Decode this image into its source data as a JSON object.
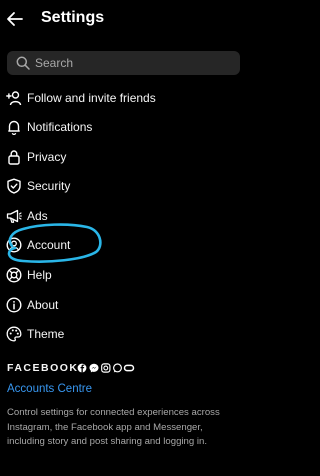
{
  "header": {
    "title": "Settings"
  },
  "search": {
    "placeholder": "Search"
  },
  "menu": {
    "items": [
      {
        "label": "Follow and invite friends"
      },
      {
        "label": "Notifications"
      },
      {
        "label": "Privacy"
      },
      {
        "label": "Security"
      },
      {
        "label": "Ads"
      },
      {
        "label": "Account"
      },
      {
        "label": "Help"
      },
      {
        "label": "About"
      },
      {
        "label": "Theme"
      }
    ]
  },
  "colors": {
    "background": "#000000",
    "text": "#f5f5f5",
    "muted_text": "#a8a8a8",
    "search_bg": "#262626",
    "link": "#3897f0",
    "highlight_stroke": "#2ab6e8"
  },
  "footer": {
    "brand": "FACEBOOK",
    "brand_icons": [
      "facebook-icon",
      "messenger-icon",
      "instagram-icon",
      "whatsapp-icon",
      "oculus-icon"
    ],
    "accounts_centre_label": "Accounts Centre",
    "description": "Control settings for connected experiences across Instagram, the Facebook app and Messenger, including story and post sharing and logging in."
  }
}
